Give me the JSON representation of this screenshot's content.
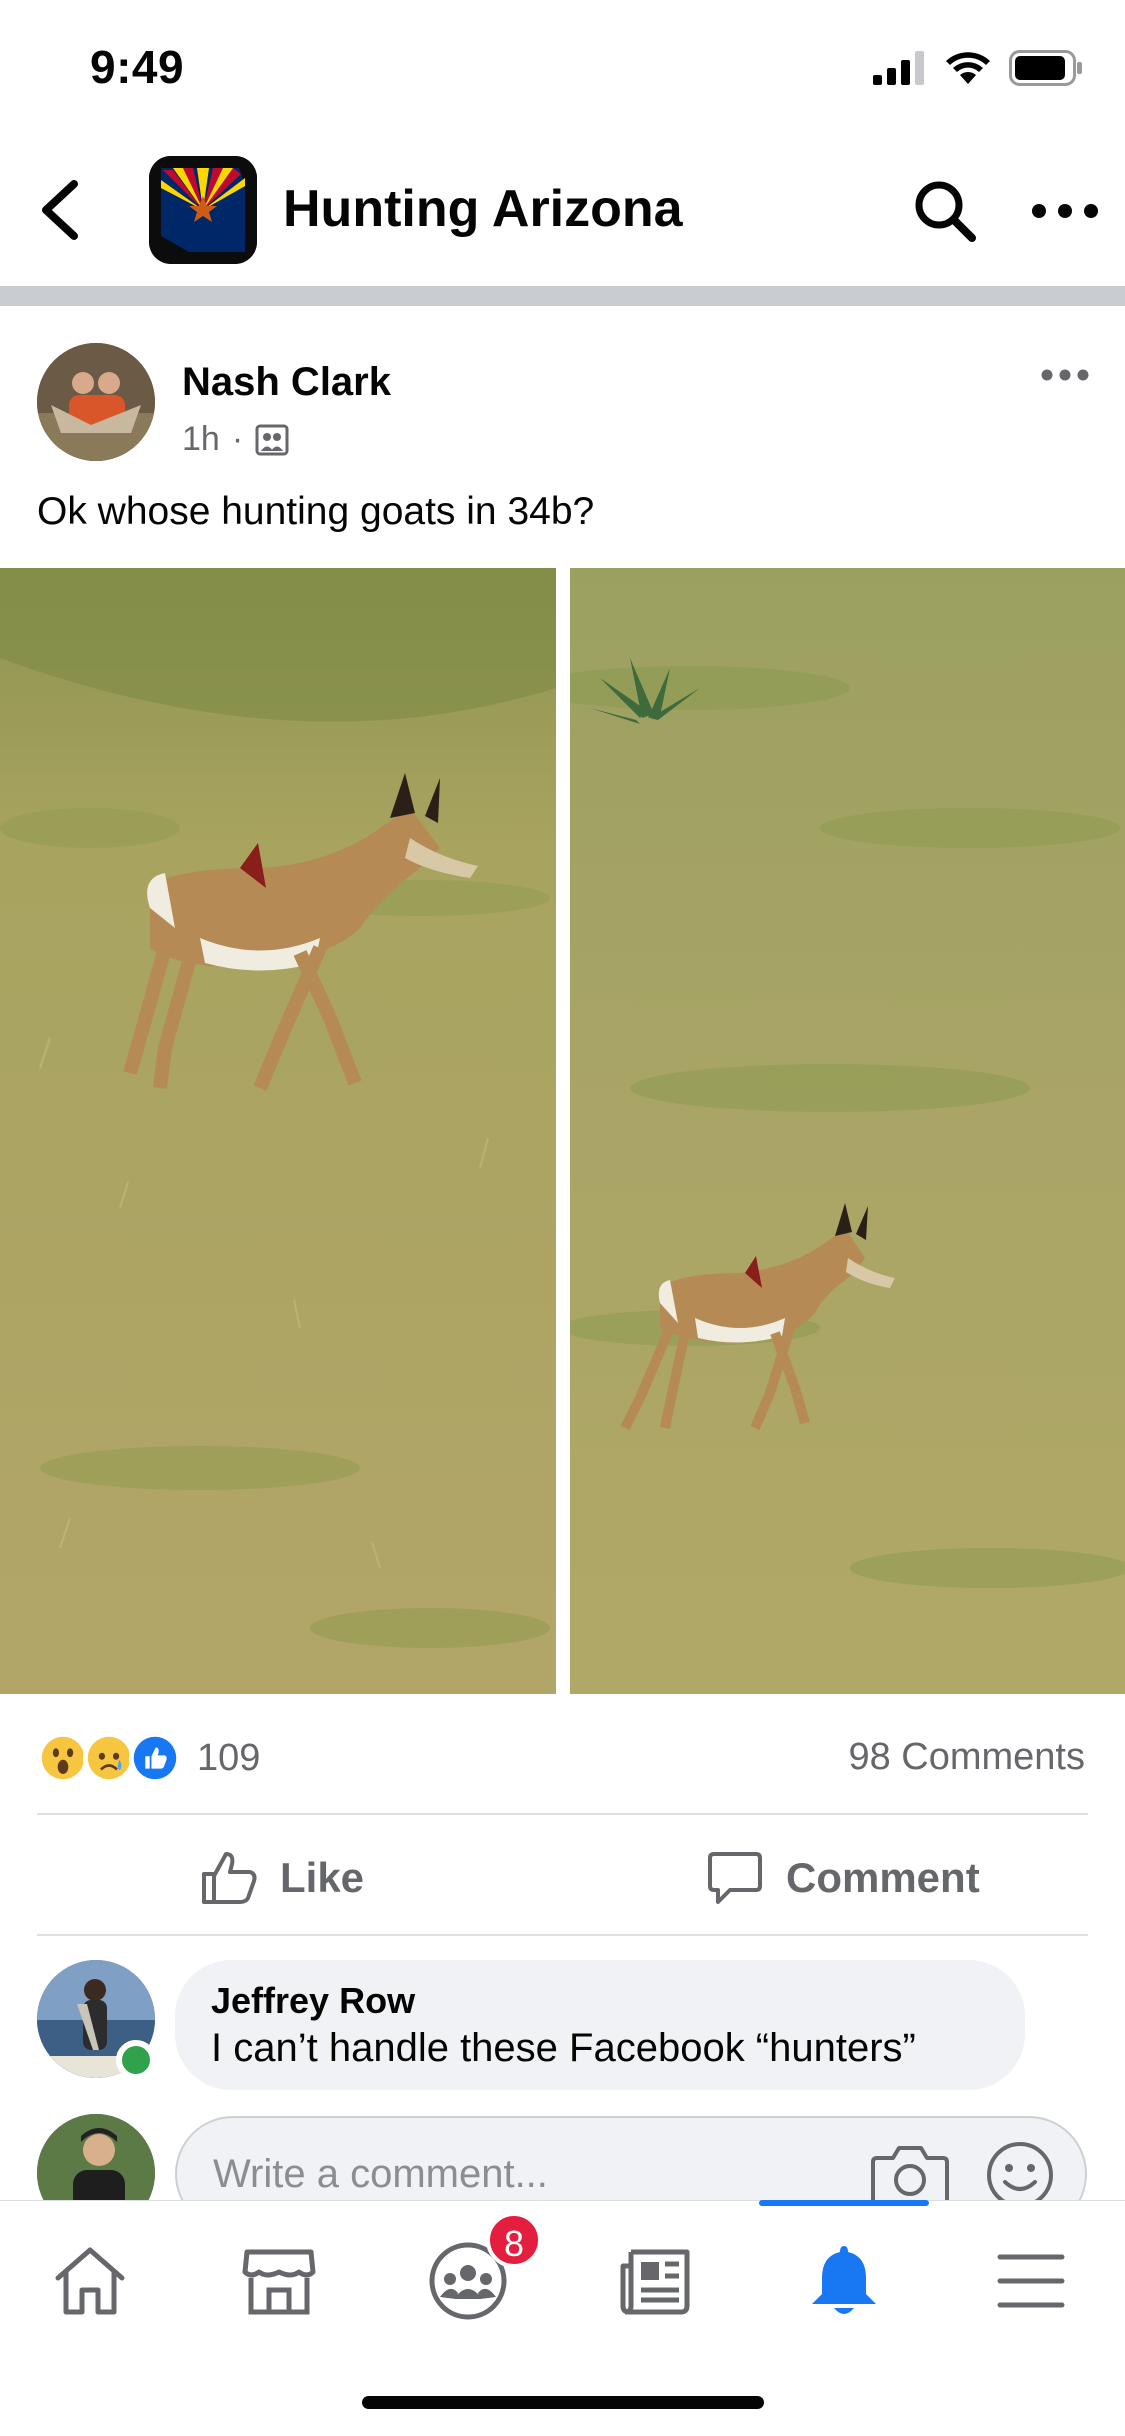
{
  "status_bar": {
    "time": "9:49"
  },
  "group": {
    "title": "Hunting Arizona"
  },
  "post": {
    "author": "Nash Clark",
    "time": "1h",
    "separator": "·",
    "text": "Ok whose hunting goats in 34b?",
    "reaction_count": "109",
    "comment_count": "98 Comments"
  },
  "actions": {
    "like": "Like",
    "comment": "Comment"
  },
  "comment": {
    "author": "Jeffrey Row",
    "text": "I can’t handle these Facebook “hunters”"
  },
  "composer": {
    "placeholder": "Write a comment..."
  },
  "tabbar": {
    "groups_badge": "8"
  },
  "colors": {
    "accent": "#1877f2",
    "badge": "#e41e3f",
    "online": "#31a24c",
    "secondary_text": "#65676b"
  },
  "icons": [
    "back-icon",
    "search-icon",
    "more-icon",
    "group-privacy-icon",
    "wow-reaction-icon",
    "sad-reaction-icon",
    "like-reaction-icon",
    "like-icon",
    "comment-icon",
    "camera-icon",
    "emoji-icon",
    "home-icon",
    "marketplace-icon",
    "groups-icon",
    "news-icon",
    "notifications-icon",
    "menu-icon"
  ]
}
